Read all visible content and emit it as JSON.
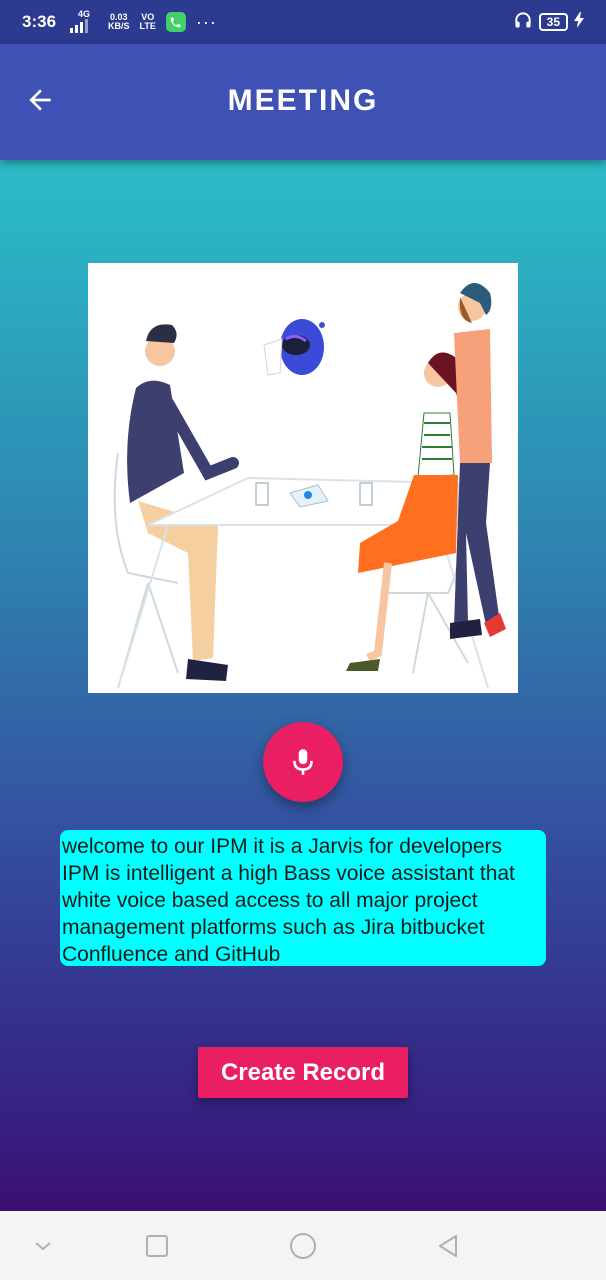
{
  "status_bar": {
    "time": "3:36",
    "network_type": "4G",
    "data_rate": "0.03",
    "data_unit": "KB/S",
    "volte_top": "VO",
    "volte_bottom": "LTE",
    "more": "···",
    "battery_level": "35"
  },
  "app_bar": {
    "title": "MEETING",
    "back_icon": "arrow-left-icon"
  },
  "illustration": {
    "description": "meeting-illustration"
  },
  "mic_button": {
    "icon": "microphone-icon",
    "color": "#e91e63"
  },
  "transcript": {
    "text": "welcome to our IPM it is a Jarvis for developers IPM is intelligent a high Bass voice assistant that white voice based access to all major project management platforms such as Jira bitbucket Confluence and GitHub",
    "background": "#00ffff"
  },
  "create_button": {
    "label": "Create Record",
    "color": "#e91e63"
  },
  "nav_bar": {
    "items": [
      "chevron-down-icon",
      "recent-apps-icon",
      "home-icon",
      "back-triangle-icon"
    ]
  }
}
